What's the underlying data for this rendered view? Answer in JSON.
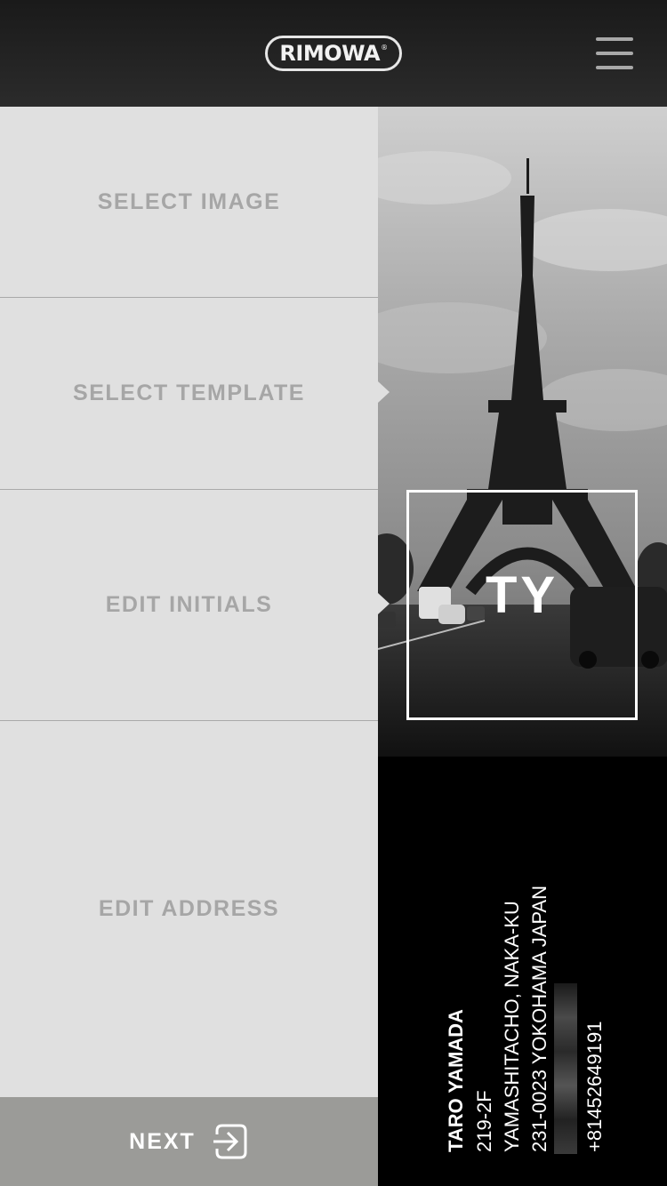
{
  "header": {
    "logo_text": "RIMOWA",
    "logo_mark": "®",
    "menu_icon": "hamburger-menu-icon"
  },
  "steps": [
    {
      "label": "SELECT IMAGE"
    },
    {
      "label": "SELECT TEMPLATE"
    },
    {
      "label": "EDIT INITIALS"
    },
    {
      "label": "EDIT ADDRESS"
    }
  ],
  "next_button": {
    "label": "NEXT",
    "icon": "arrow-right-box-icon"
  },
  "preview": {
    "initials": "TY",
    "address_lines": [
      "TARO YAMADA",
      "219-2F",
      "YAMASHITACHO, NAKA-KU",
      "231-0023 YOKOHAMA JAPAN",
      "+81452649191"
    ]
  },
  "colors": {
    "header_bg": "#222222",
    "panel_bg": "#e0e0e0",
    "step_text": "#a6a6a6",
    "next_bg": "#9b9b98"
  }
}
